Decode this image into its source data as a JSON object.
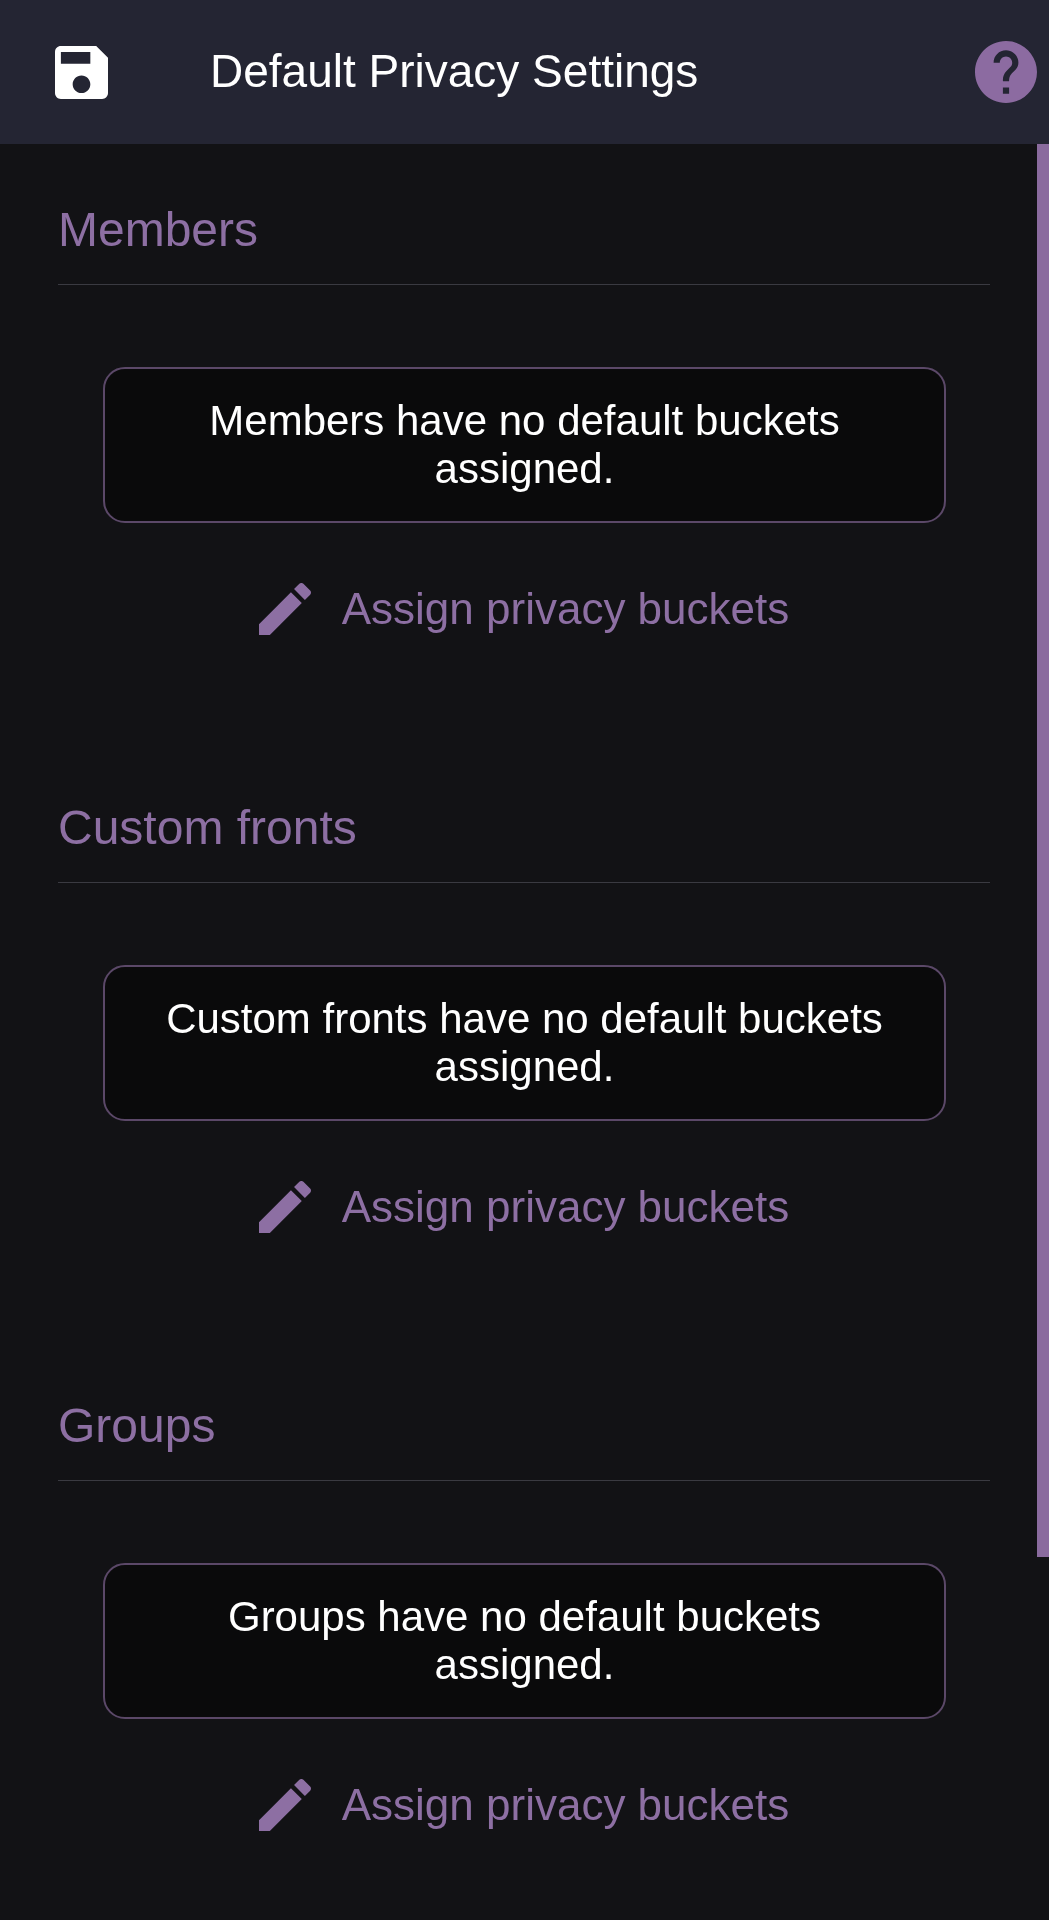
{
  "header": {
    "title": "Default Privacy Settings"
  },
  "sections": [
    {
      "title": "Members",
      "message": "Members have no default buckets assigned.",
      "action": "Assign privacy buckets"
    },
    {
      "title": "Custom fronts",
      "message": "Custom fronts have no default buckets assigned.",
      "action": "Assign privacy buckets"
    },
    {
      "title": "Groups",
      "message": "Groups have no default buckets assigned.",
      "action": "Assign privacy buckets"
    }
  ]
}
